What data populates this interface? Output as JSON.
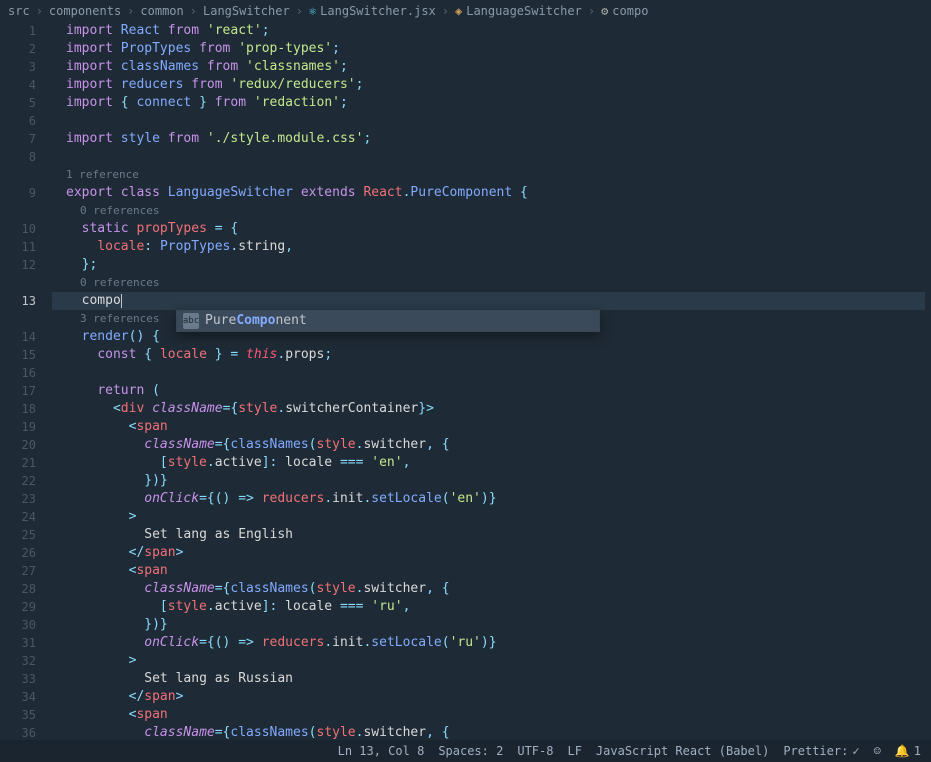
{
  "breadcrumb": [
    {
      "label": "src",
      "icon": ""
    },
    {
      "label": "components",
      "icon": ""
    },
    {
      "label": "common",
      "icon": ""
    },
    {
      "label": "LangSwitcher",
      "icon": ""
    },
    {
      "label": "LangSwitcher.jsx",
      "icon": "react"
    },
    {
      "label": "LanguageSwitcher",
      "icon": "lang"
    },
    {
      "label": "compo",
      "icon": "func"
    }
  ],
  "codelens": {
    "ref1": "1 reference",
    "ref0a": "0 references",
    "ref0b": "0 references",
    "ref3": "3 references"
  },
  "code": {
    "l1": {
      "a": "import",
      "b": "React",
      "c": "from",
      "d": "'react'",
      "e": ";"
    },
    "l2": {
      "a": "import",
      "b": "PropTypes",
      "c": "from",
      "d": "'prop-types'",
      "e": ";"
    },
    "l3": {
      "a": "import",
      "b": "classNames",
      "c": "from",
      "d": "'classnames'",
      "e": ";"
    },
    "l4": {
      "a": "import",
      "b": "reducers",
      "c": "from",
      "d": "'redux/reducers'",
      "e": ";"
    },
    "l5": {
      "a": "import",
      "b": "{ ",
      "c": "connect",
      "d": " }",
      "e": "from",
      "f": "'redaction'",
      "g": ";"
    },
    "l7": {
      "a": "import",
      "b": "style",
      "c": "from",
      "d": "'./style.module.css'",
      "e": ";"
    },
    "l9": {
      "a": "export",
      "b": "class",
      "c": "LanguageSwitcher",
      "d": "extends",
      "e": "React",
      "f": ".",
      "g": "PureComponent",
      "h": "{"
    },
    "l10": {
      "a": "static",
      "b": "propTypes",
      "c": " = {"
    },
    "l11": {
      "a": "locale",
      "b": ": ",
      "c": "PropTypes",
      "d": ".",
      "e": "string",
      "f": ","
    },
    "l12": {
      "a": "};"
    },
    "l13": {
      "a": "compo"
    },
    "l14": {
      "a": "render",
      "b": "() {"
    },
    "l15": {
      "a": "const",
      "b": " { ",
      "c": "locale",
      "d": " } = ",
      "e": "this",
      "f": ".",
      "g": "props",
      "h": ";"
    },
    "l17": {
      "a": "return",
      "b": " ("
    },
    "l18": {
      "a": "<",
      "b": "div",
      "c": " className",
      "d": "={",
      "e": "style",
      "f": ".",
      "g": "switcherContainer",
      "h": "}>"
    },
    "l19": {
      "a": "<",
      "b": "span"
    },
    "l20": {
      "a": "className",
      "b": "={",
      "c": "classNames",
      "d": "(",
      "e": "style",
      "f": ".",
      "g": "switcher",
      "h": ", {"
    },
    "l21": {
      "a": "[",
      "b": "style",
      "c": ".",
      "d": "active",
      "e": "]: ",
      "f": "locale",
      "g": " === ",
      "h": "'en'",
      "i": ","
    },
    "l22": {
      "a": "})}"
    },
    "l23": {
      "a": "onClick",
      "b": "={",
      "c": "()",
      "d": " => ",
      "e": "reducers",
      "f": ".",
      "g": "init",
      "h": ".",
      "i": "setLocale",
      "j": "(",
      "k": "'en'",
      "l": ")}"
    },
    "l24": {
      "a": ">"
    },
    "l25": {
      "a": "Set lang as English"
    },
    "l26": {
      "a": "</",
      "b": "span",
      "c": ">"
    },
    "l27": {
      "a": "<",
      "b": "span"
    },
    "l28": {
      "a": "className",
      "b": "={",
      "c": "classNames",
      "d": "(",
      "e": "style",
      "f": ".",
      "g": "switcher",
      "h": ", {"
    },
    "l29": {
      "a": "[",
      "b": "style",
      "c": ".",
      "d": "active",
      "e": "]: ",
      "f": "locale",
      "g": " === ",
      "h": "'ru'",
      "i": ","
    },
    "l30": {
      "a": "})}"
    },
    "l31": {
      "a": "onClick",
      "b": "={",
      "c": "()",
      "d": " => ",
      "e": "reducers",
      "f": ".",
      "g": "init",
      "h": ".",
      "i": "setLocale",
      "j": "(",
      "k": "'ru'",
      "l": ")}"
    },
    "l32": {
      "a": ">"
    },
    "l33": {
      "a": "Set lang as Russian"
    },
    "l34": {
      "a": "</",
      "b": "span",
      "c": ">"
    },
    "l35": {
      "a": "<",
      "b": "span"
    },
    "l36": {
      "a": "className",
      "b": "={",
      "c": "classNames",
      "d": "(",
      "e": "style",
      "f": ".",
      "g": "switcher",
      "h": ", {"
    }
  },
  "suggest": {
    "items": [
      {
        "pre": "Pure",
        "match": "Compo",
        "post": "nent"
      }
    ]
  },
  "status": {
    "lncol": "Ln 13, Col 8",
    "spaces": "Spaces: 2",
    "encoding": "UTF-8",
    "eol": "LF",
    "lang": "JavaScript React (Babel)",
    "prettier": "Prettier:",
    "bell_count": "1"
  }
}
